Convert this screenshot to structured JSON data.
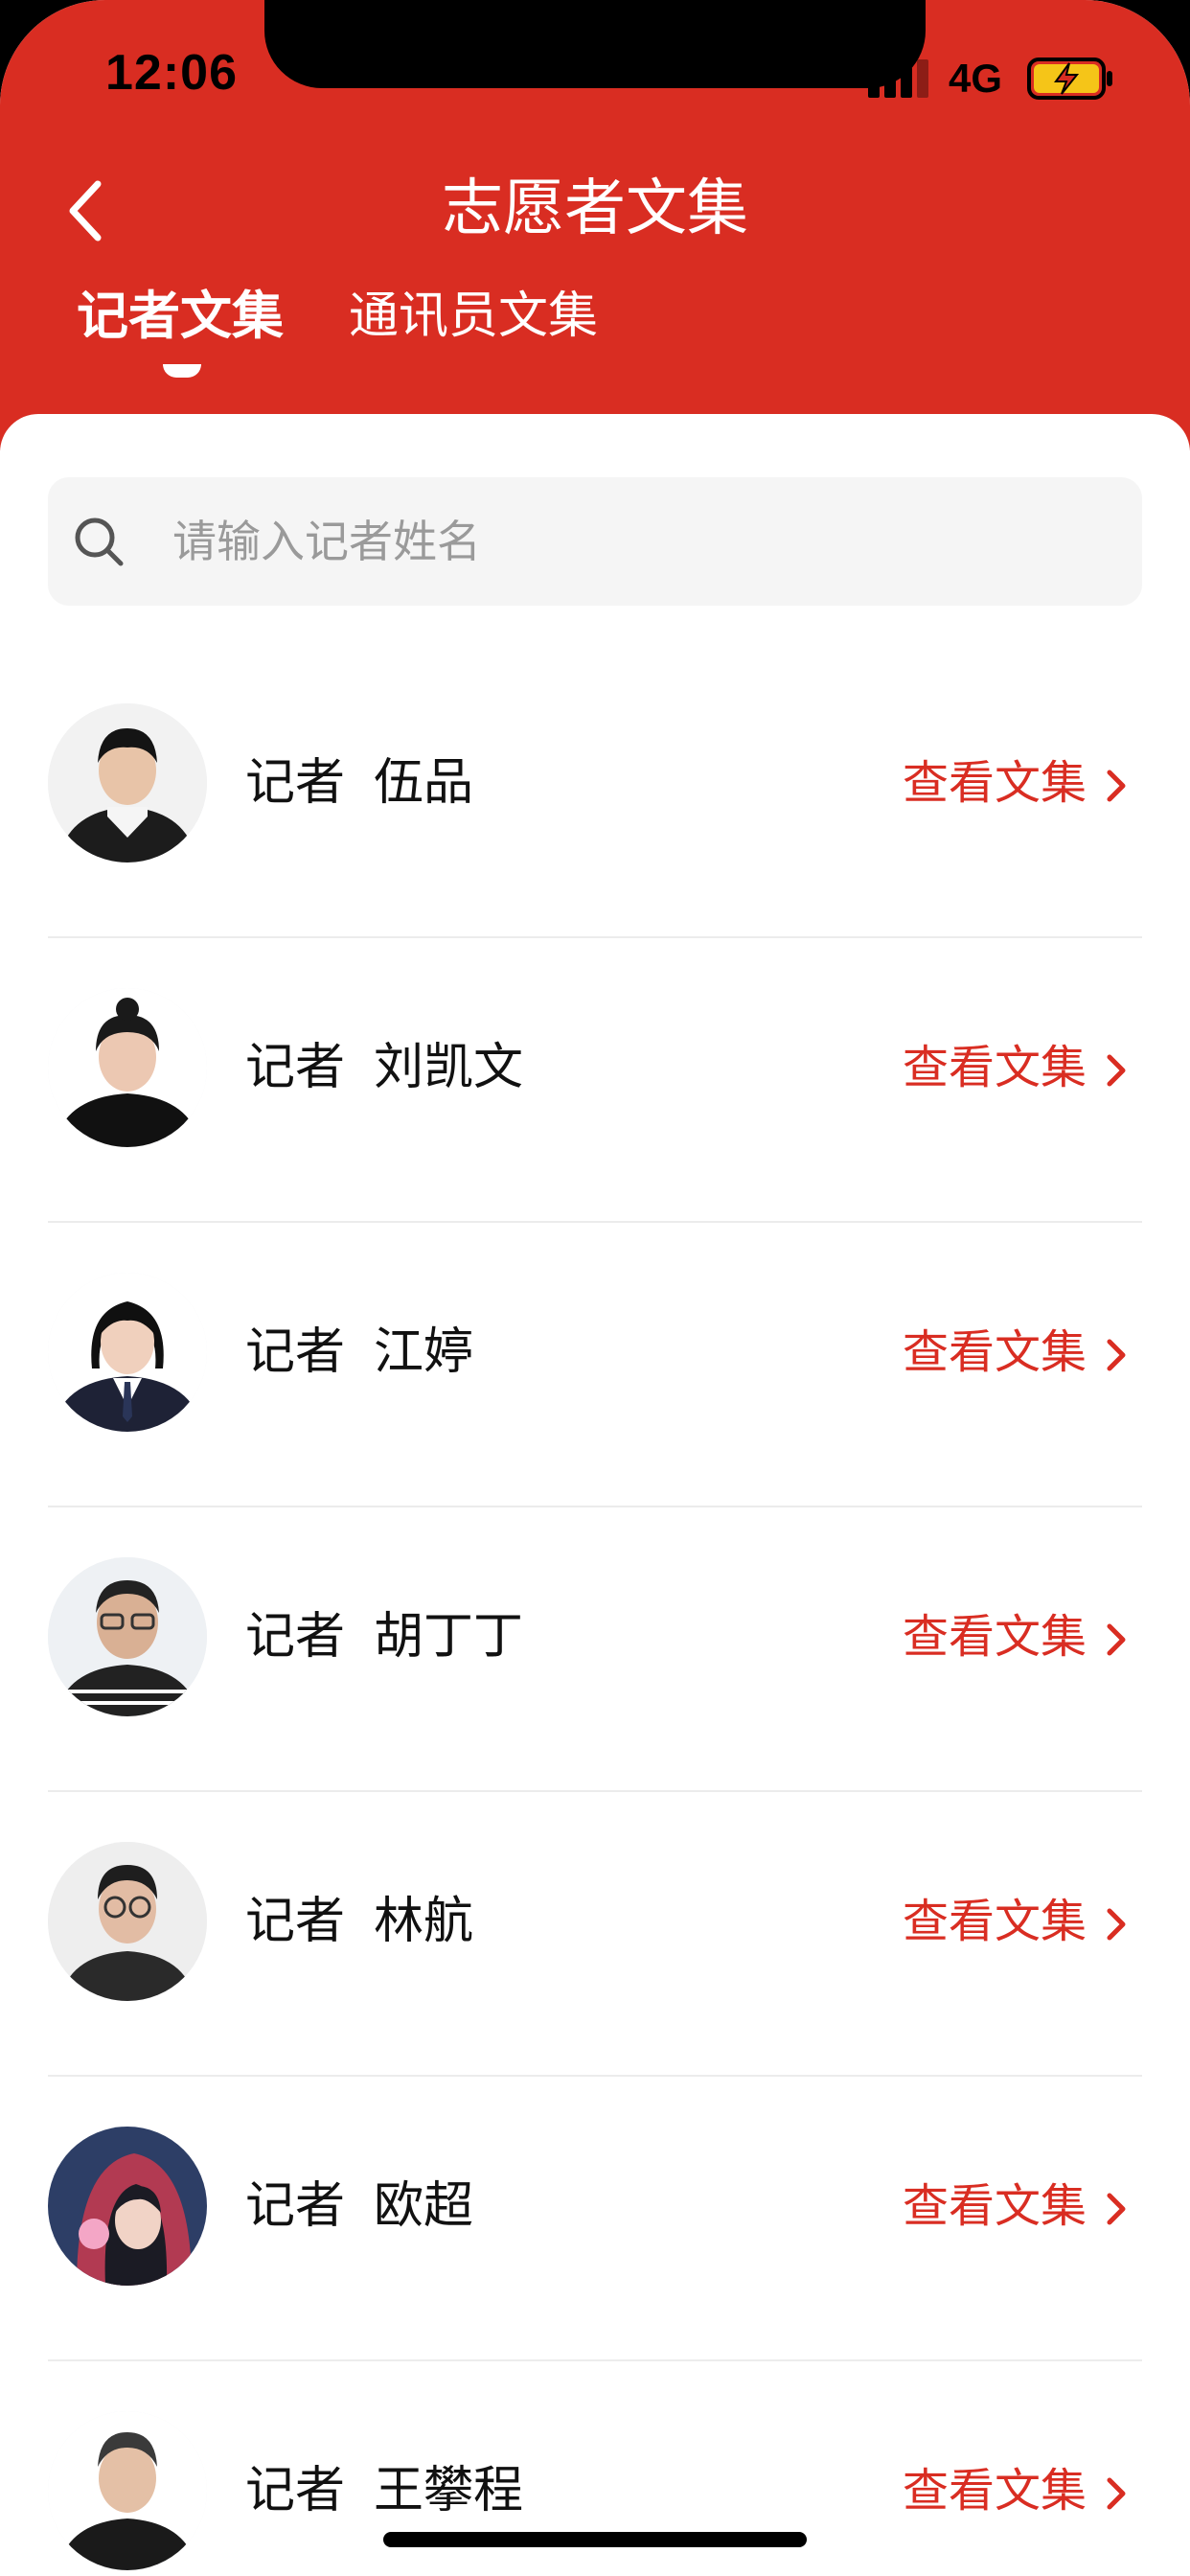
{
  "status_bar": {
    "time": "12:06",
    "network": "4G"
  },
  "nav": {
    "title": "志愿者文集"
  },
  "tabs": [
    {
      "label": "记者文集",
      "active": true
    },
    {
      "label": "通讯员文集",
      "active": false
    }
  ],
  "search": {
    "placeholder": "请输入记者姓名",
    "value": ""
  },
  "reporters": [
    {
      "label": "记者",
      "name": "伍品",
      "action": "查看文集",
      "avatar_bg": "#f2f2f2",
      "shirt": "#1c1c1c"
    },
    {
      "label": "记者",
      "name": "刘凯文",
      "action": "查看文集",
      "avatar_bg": "#ffffff",
      "shirt": "#111111"
    },
    {
      "label": "记者",
      "name": "江婷",
      "action": "查看文集",
      "avatar_bg": "#ffffff",
      "shirt": "#1e2236"
    },
    {
      "label": "记者",
      "name": "胡丁丁",
      "action": "查看文集",
      "avatar_bg": "#eef1f4",
      "shirt": "#222222"
    },
    {
      "label": "记者",
      "name": "林航",
      "action": "查看文集",
      "avatar_bg": "#eeeeee",
      "shirt": "#2a2a2a"
    },
    {
      "label": "记者",
      "name": "欧超",
      "action": "查看文集",
      "avatar_bg": "#2d3e66",
      "shirt": "#b23a52"
    },
    {
      "label": "记者",
      "name": "王攀程",
      "action": "查看文集",
      "avatar_bg": "#ffffff",
      "shirt": "#1a1a1a"
    }
  ],
  "colors": {
    "brand_red": "#d92d22",
    "link_red": "#d92d22"
  }
}
